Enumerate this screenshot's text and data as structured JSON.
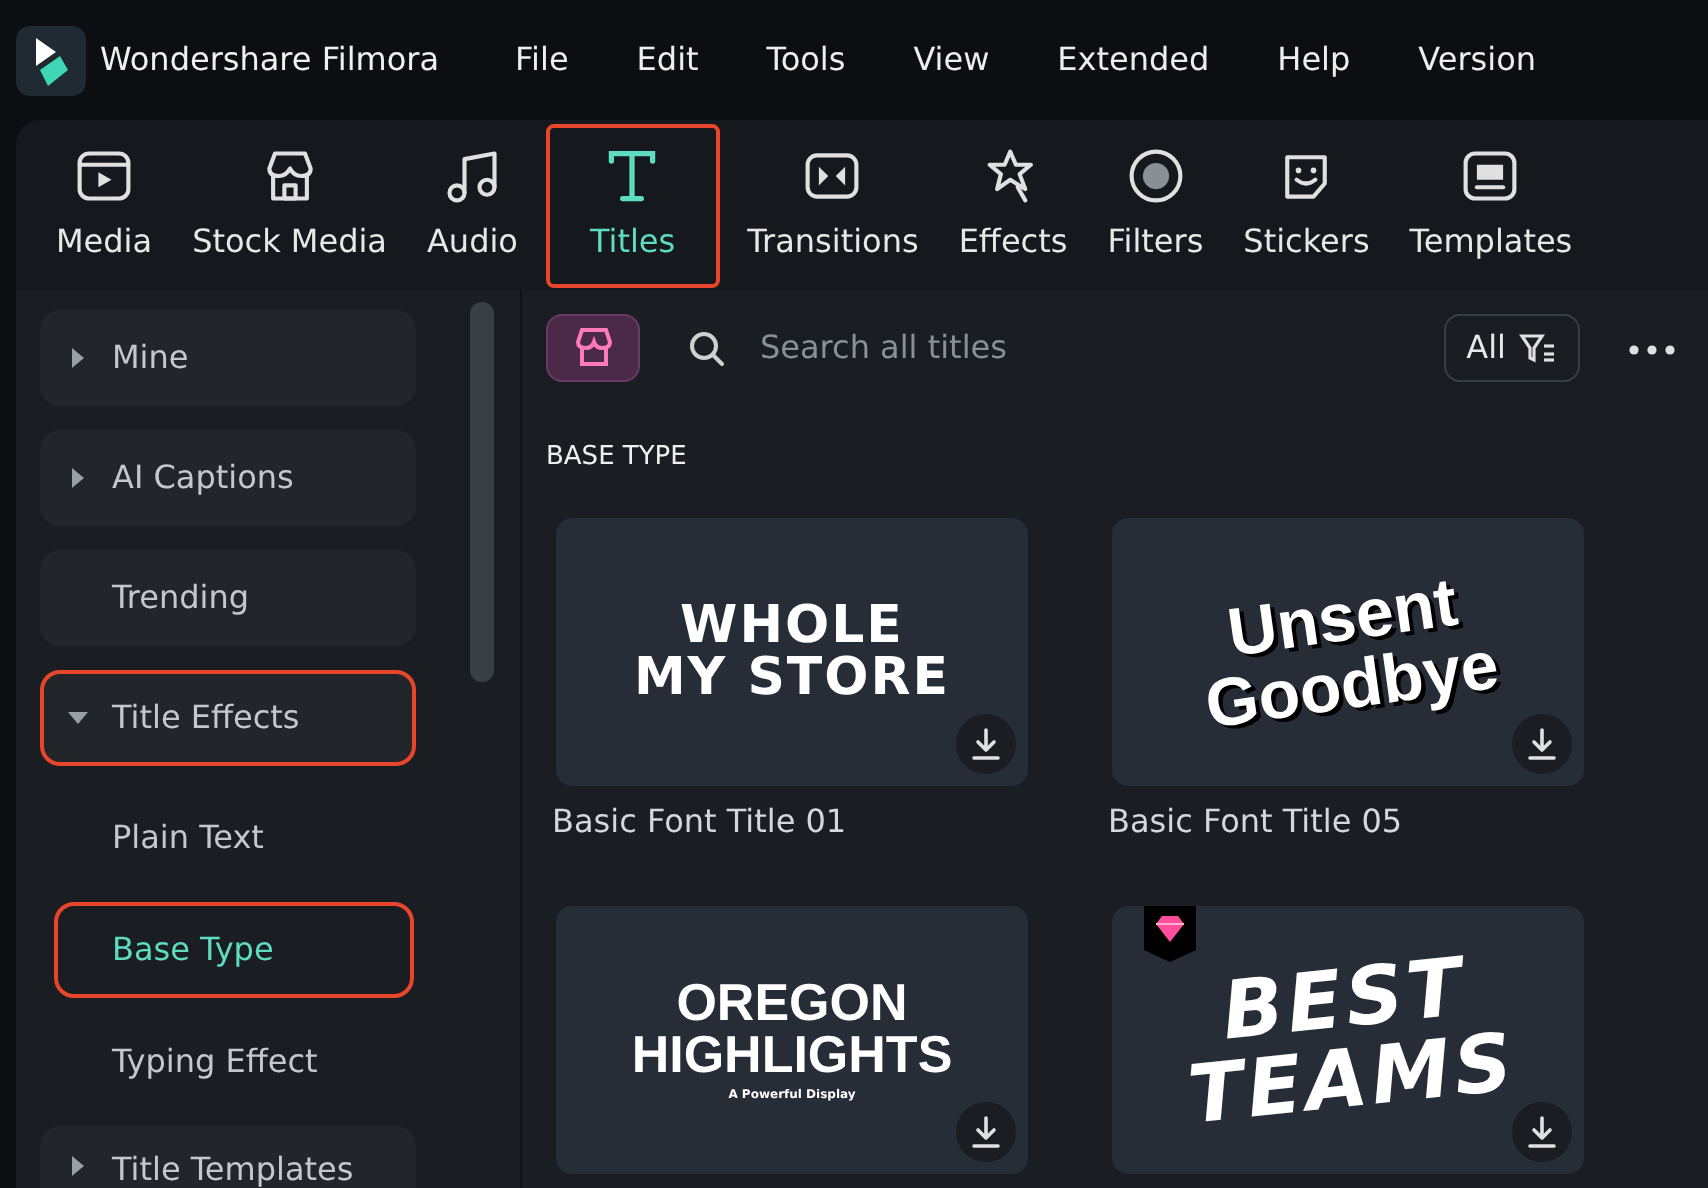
{
  "app": {
    "title": "Wondershare Filmora"
  },
  "menu": [
    "File",
    "Edit",
    "Tools",
    "View",
    "Extended",
    "Help",
    "Version"
  ],
  "tabs": [
    {
      "label": "Media",
      "selected": false,
      "highlighted": false
    },
    {
      "label": "Stock Media",
      "selected": false,
      "highlighted": false
    },
    {
      "label": "Audio",
      "selected": false,
      "highlighted": false
    },
    {
      "label": "Titles",
      "selected": true,
      "highlighted": true
    },
    {
      "label": "Transitions",
      "selected": false,
      "highlighted": false
    },
    {
      "label": "Effects",
      "selected": false,
      "highlighted": false
    },
    {
      "label": "Filters",
      "selected": false,
      "highlighted": false
    },
    {
      "label": "Stickers",
      "selected": false,
      "highlighted": false
    },
    {
      "label": "Templates",
      "selected": false,
      "highlighted": false
    }
  ],
  "sidebar": [
    {
      "kind": "category",
      "label": "Mine",
      "expanded": false,
      "highlighted": false
    },
    {
      "kind": "category",
      "label": "AI Captions",
      "expanded": false,
      "highlighted": false
    },
    {
      "kind": "category",
      "label": "Trending",
      "highlighted": false
    },
    {
      "kind": "category",
      "label": "Title Effects",
      "expanded": true,
      "highlighted": true
    },
    {
      "kind": "subitem",
      "label": "Plain Text",
      "selected": false,
      "highlighted": false
    },
    {
      "kind": "subitem",
      "label": "Base Type",
      "selected": true,
      "highlighted": true
    },
    {
      "kind": "subitem",
      "label": "Typing Effect",
      "selected": false,
      "highlighted": false
    },
    {
      "kind": "category",
      "label": "Title Templates",
      "expanded": false,
      "highlighted": false
    }
  ],
  "search": {
    "placeholder": "Search all titles"
  },
  "filter": {
    "label": "All"
  },
  "section_title": "BASE TYPE",
  "cards": [
    {
      "caption": "Basic Font Title 01",
      "preview": [
        "WHOLE",
        "MY STORE"
      ],
      "premium": false
    },
    {
      "caption": "Basic Font Title 05",
      "preview": [
        "Unsent",
        "Goodbye"
      ],
      "premium": false
    },
    {
      "preview": [
        "OREGON",
        "HIGHLIGHTS"
      ],
      "tagline": "A Powerful Display",
      "premium": false
    },
    {
      "preview": [
        "BEST",
        "TEAMS"
      ],
      "premium": true
    }
  ]
}
